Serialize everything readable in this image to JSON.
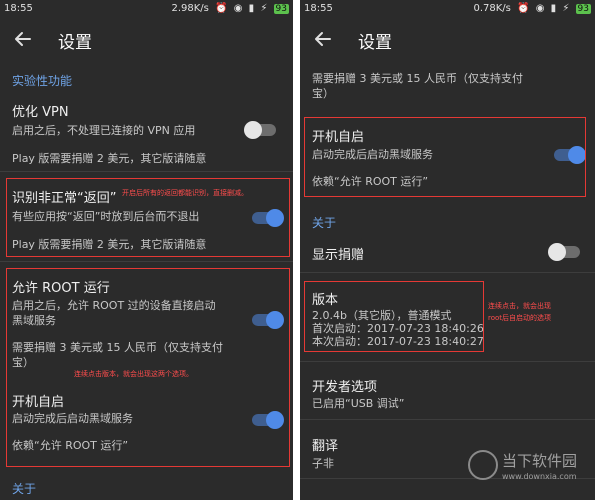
{
  "left": {
    "status": {
      "time": "18:55",
      "net": "2.98K/s",
      "battery": "93"
    },
    "title": "设置",
    "section_experimental": "实验性功能",
    "optimize_vpn": {
      "title": "优化 VPN",
      "summary": "启用之后，不处理已连接的 VPN 应用",
      "note": "Play 版需要捐赠 2 美元，其它版请随意"
    },
    "back_key": {
      "title": "识别非正常“返回”",
      "summary": "有些应用按“返回”时放到后台而不退出",
      "note": "Play 版需要捐赠 2 美元，其它版请随意"
    },
    "allow_root": {
      "title": "允许 ROOT 运行",
      "summary_1": "启用之后，允许 ROOT 过的设备直接启动",
      "summary_2": "黑域服务",
      "note_1": "需要捐赠 3 美元或 15 人民币（仅支持支付",
      "note_2": "宝）"
    },
    "boot_start": {
      "title": "开机自启",
      "summary": "启动完成后启动黑域服务",
      "depends": "依赖“允许 ROOT 运行”"
    },
    "section_about": "关于",
    "annot_1": "开启后所有的返回都能识别，直接删减。",
    "annot_2": "连续点击版本，就会出现这两个选项。"
  },
  "right": {
    "status": {
      "time": "18:55",
      "net": "0.78K/s",
      "battery": "93"
    },
    "title": "设置",
    "donate_line_1": "需要捐赠 3 美元或 15 人民币（仅支持支付",
    "donate_line_2": "宝）",
    "boot_start": {
      "title": "开机自启",
      "summary": "启动完成后启动黑域服务",
      "depends": "依赖“允许 ROOT 运行”"
    },
    "section_about": "关于",
    "show_donate": "显示捐赠",
    "version": {
      "title": "版本",
      "line_1": "2.0.4b（其它版），普通模式",
      "line_2": "首次启动：2017-07-23 18:40:26",
      "line_3": "本次启动：2017-07-23 18:40:27"
    },
    "developer": {
      "title": "开发者选项",
      "summary": "已启用“USB 调试”"
    },
    "translate": {
      "title": "翻译",
      "summary": "子非"
    },
    "annot_1": "连续点击，就会出现",
    "annot_2": "root后自启动的选项"
  },
  "watermark": {
    "name": "当下软件园",
    "url": "www.downxia.com"
  },
  "colors": {
    "background": "#2b2b2b",
    "accent": "#4f8ae8",
    "section": "#6fa3e6",
    "annotation": "#e53935"
  },
  "toggles": {
    "optimize_vpn": false,
    "back_key": true,
    "allow_root": true,
    "boot_start_left": true,
    "boot_start_right": true,
    "show_donate": false
  },
  "icons": [
    "back-arrow-icon",
    "wifi-icon",
    "alarm-icon",
    "battery-icon",
    "signal-icon",
    "charging-icon"
  ]
}
